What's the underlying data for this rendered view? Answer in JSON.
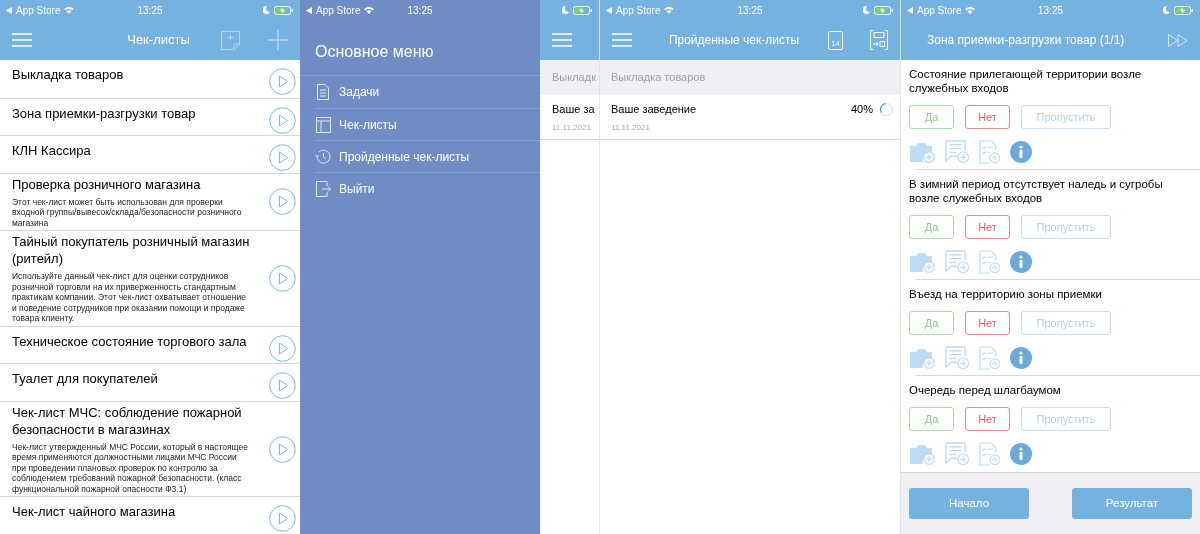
{
  "checklists_screen": {
    "status_bar": {
      "carrier": "App Store",
      "time": "13:25"
    },
    "title": "Чек-листы",
    "items": [
      {
        "title": "Выкладка товаров"
      },
      {
        "title": "Зона приемки-разгрузки товар"
      },
      {
        "title": "КЛН Кассира"
      },
      {
        "title": "Проверка розничного магазина",
        "description": "Этот чек-лист может быть использован для проверки входной группы/вывесок/склада/безопасности розничного магазина"
      },
      {
        "title": "Тайный покупатель розничный магазин (ритейл)",
        "description": "Используйте данный чек-лист для оценки сотрудников розничной торговли на их приверженность стандартным практикам компании. Этот чек-лист охватывает отношение и поведение сотрудников при оказании помощи и продаже товара клиенту."
      },
      {
        "title": "Техническое состояние торгового зала"
      },
      {
        "title": "Туалет для покупателей"
      },
      {
        "title": "Чек-лист МЧС: соблюдение пожарной безопасности в магазинах",
        "description": "Чек-лист утвержденный МЧС России,  который в настоящее время применяются должностными лицами МЧС России при проведении плановых проверок по контролю за соблюдением требований пожарной безопасности. (класс функциональной пожарной опасности Ф3.1)"
      },
      {
        "title": "Чек-лист чайного магазина"
      }
    ]
  },
  "menu_screen": {
    "status_bar": {
      "carrier": "App Store",
      "time": "13:25"
    },
    "title": "Основное меню",
    "items": [
      {
        "label": "Задачи",
        "kind": "tasks"
      },
      {
        "label": "Чек-листы",
        "kind": "checklists"
      },
      {
        "label": "Пройденные чек-листы",
        "kind": "history"
      },
      {
        "label": "Выйти",
        "kind": "logout"
      }
    ]
  },
  "history_screen": {
    "background_peek": {
      "section": "Выкладк",
      "row_title": "Ваше за",
      "row_date": "11.11.2021"
    },
    "status_bar": {
      "carrier": "App Store",
      "time": "13:25"
    },
    "title": "Пройденные чек-листы",
    "calendar_day": "14",
    "section": "Выкладка товаров",
    "rows": [
      {
        "title": "Ваше заведение",
        "date": "11.11.2021",
        "percent": "40%"
      }
    ]
  },
  "question_screen": {
    "status_bar": {
      "carrier": "App Store",
      "time": "13:25"
    },
    "title": "Зона приемки-разгрузки товар (1/1)",
    "questions": [
      {
        "text": "Состояние прилегающей территории возле служебных входов",
        "answers": [
          {
            "label": "Да",
            "kind": "yes"
          },
          {
            "label": "Нет",
            "kind": "no"
          },
          {
            "label": "Пропустить",
            "kind": "skip"
          }
        ]
      },
      {
        "text": "В зимний период отсутствует наледь и сугробы возле служебных входов",
        "answers": [
          {
            "label": "Да",
            "kind": "yes"
          },
          {
            "label": "Нет",
            "kind": "no"
          },
          {
            "label": "Пропустить",
            "kind": "skip"
          }
        ]
      },
      {
        "text": "Въезд на территорию зоны приемки",
        "answers": [
          {
            "label": "Да",
            "kind": "yes"
          },
          {
            "label": "Нет",
            "kind": "no"
          },
          {
            "label": "Пропустить",
            "kind": "skip"
          }
        ]
      },
      {
        "text": "Очередь перед шлагбаумом",
        "answers": [
          {
            "label": "Да",
            "kind": "yes"
          },
          {
            "label": "Нет",
            "kind": "no"
          },
          {
            "label": "Пропустить",
            "kind": "skip"
          }
        ]
      }
    ],
    "footer_buttons": [
      "Начало",
      "Результат"
    ]
  }
}
